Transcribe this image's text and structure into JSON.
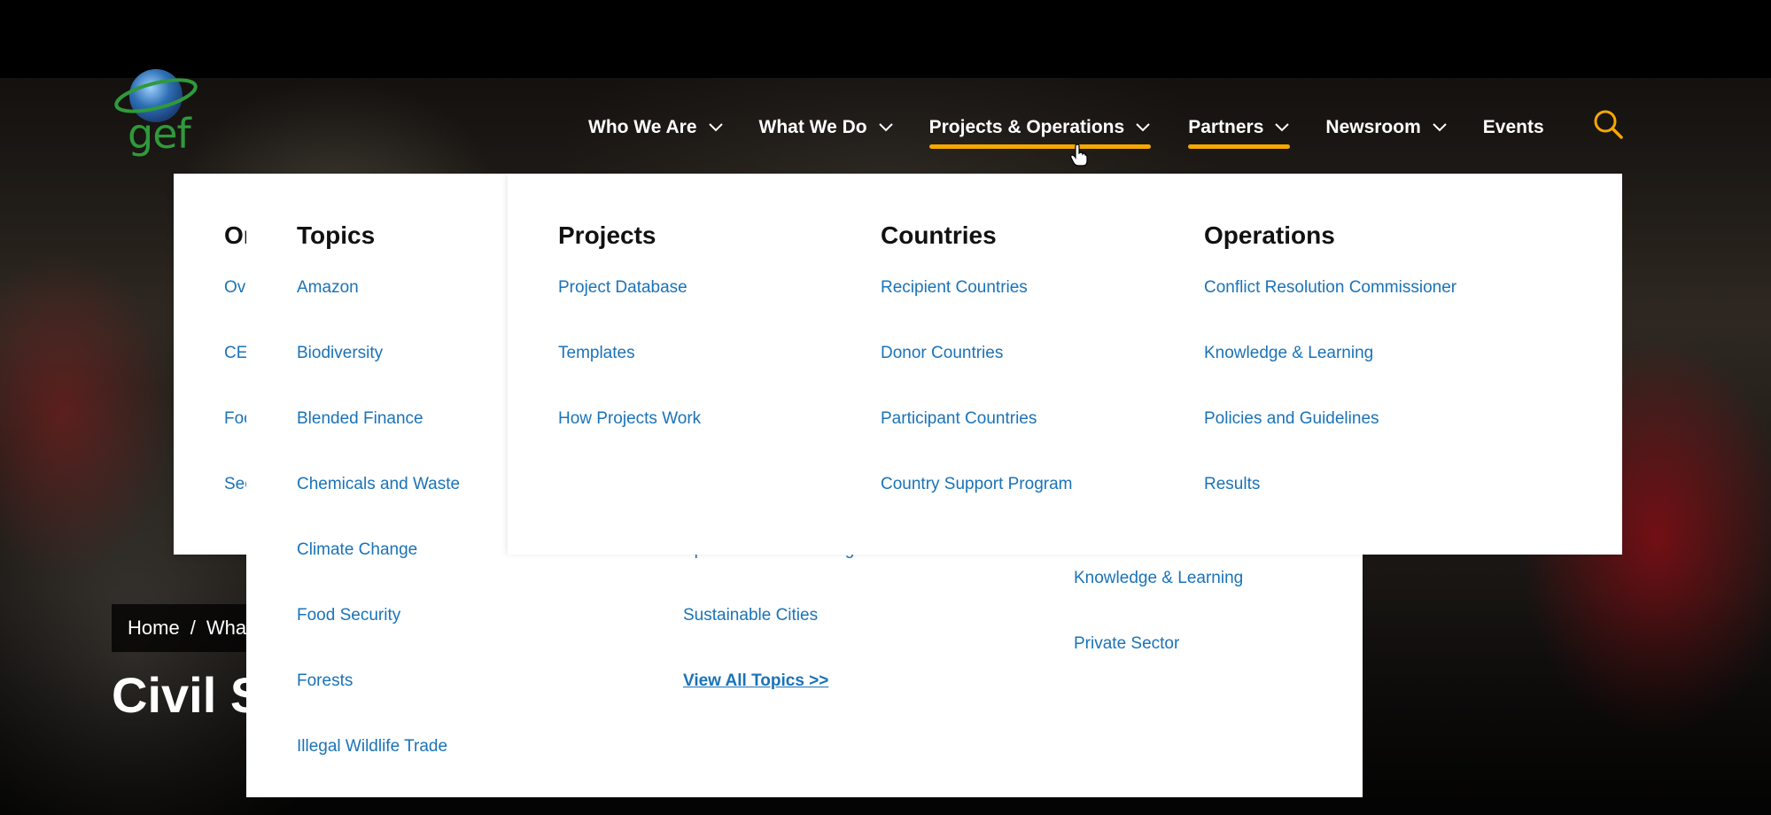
{
  "brand": {
    "logo_text": "gef"
  },
  "nav": {
    "items": [
      {
        "label": "Who We Are"
      },
      {
        "label": "What We Do"
      },
      {
        "label": "Projects & Operations"
      },
      {
        "label": "Partners"
      },
      {
        "label": "Newsroom"
      },
      {
        "label": "Events"
      }
    ],
    "accent_color": "#f5a800"
  },
  "background_menu": {
    "heading_partial": "Or",
    "items_partial": [
      "Ove",
      "CE",
      "Foc",
      "Sec"
    ]
  },
  "topics_menu": {
    "heading": "Topics",
    "col1": [
      "Amazon",
      "Biodiversity",
      "Blended Finance",
      "Chemicals and Waste",
      "Climate Change",
      "Food Security",
      "Forests",
      "Illegal Wildlife Trade"
    ],
    "col2": [
      "Special Climate Change Fund",
      "Sustainable Cities"
    ],
    "view_all": "View All Topics >>",
    "col3": [
      "Knowledge & Learning",
      "Private Sector"
    ]
  },
  "projects_menu": {
    "columns": [
      {
        "heading": "Projects",
        "links": [
          "Project Database",
          "Templates",
          "How Projects Work"
        ]
      },
      {
        "heading": "Countries",
        "links": [
          "Recipient Countries",
          "Donor Countries",
          "Participant Countries",
          "Country Support Program"
        ]
      },
      {
        "heading": "Operations",
        "links": [
          "Conflict Resolution Commissioner",
          "Knowledge & Learning",
          "Policies and Guidelines",
          "Results"
        ]
      }
    ]
  },
  "breadcrumb": {
    "home": "Home",
    "separator": "/",
    "current_partial": "Wha"
  },
  "page_title_partial": "Civil S",
  "colors": {
    "link": "#1a73b8",
    "heading": "#111111",
    "logo_green": "#2f9a3b",
    "globe_blue": "#2d6fb3"
  }
}
